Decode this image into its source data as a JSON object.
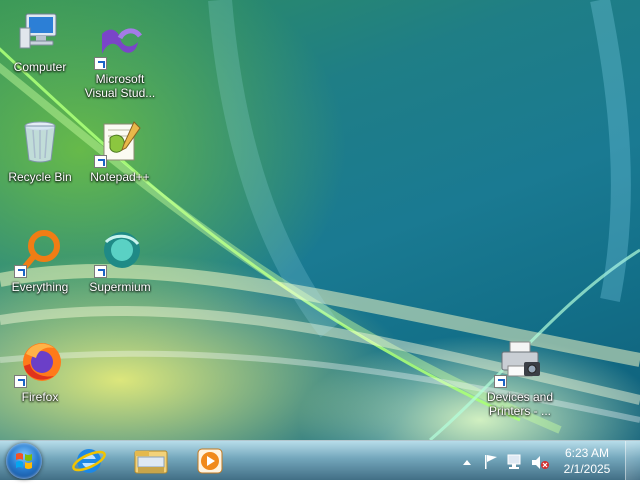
{
  "desktop": {
    "icons": [
      {
        "label": "Computer"
      },
      {
        "label": "Microsoft Visual Stud..."
      },
      {
        "label": "Recycle Bin"
      },
      {
        "label": "Notepad++"
      },
      {
        "label": "Everything"
      },
      {
        "label": "Supermium"
      },
      {
        "label": "Firefox"
      },
      {
        "label": "Devices and Printers - ..."
      }
    ]
  },
  "taskbar": {
    "pinned": [
      {
        "icon": "internet-explorer-icon"
      },
      {
        "icon": "file-explorer-icon"
      },
      {
        "icon": "media-player-icon"
      }
    ],
    "clock": {
      "time": "6:23 AM",
      "date": "2/1/2025"
    }
  },
  "colors": {
    "taskbar": "#4f8eaa",
    "accent": "#1b63c6"
  }
}
